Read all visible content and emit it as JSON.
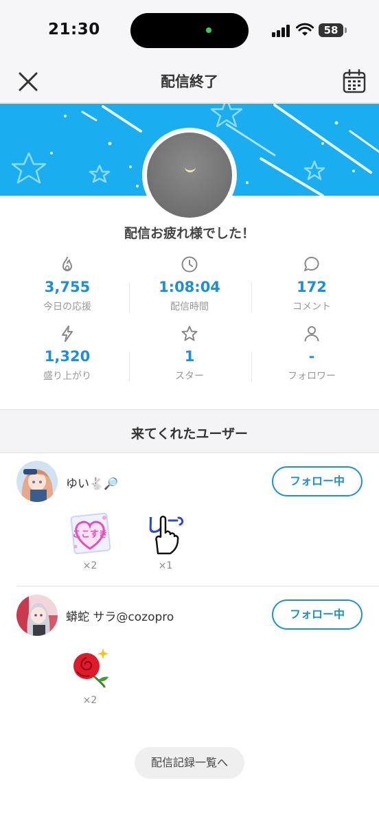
{
  "status_bar": {
    "time": "21:30",
    "battery": "58"
  },
  "nav": {
    "title": "配信終了",
    "close_icon": "close-icon",
    "calendar_icon": "calendar-icon"
  },
  "summary": {
    "message": "配信お疲れ様でした！"
  },
  "stats": [
    {
      "icon": "flame-icon",
      "value": "3,755",
      "label": "今日の応援"
    },
    {
      "icon": "clock-icon",
      "value": "1:08:04",
      "label": "配信時間"
    },
    {
      "icon": "comment-icon",
      "value": "172",
      "label": "コメント"
    },
    {
      "icon": "bolt-icon",
      "value": "1,320",
      "label": "盛り上がり"
    },
    {
      "icon": "star-icon",
      "value": "1",
      "label": "スター"
    },
    {
      "icon": "person-icon",
      "value": "-",
      "label": "フォロワー"
    }
  ],
  "visitors": {
    "title": "来てくれたユーザー",
    "users": [
      {
        "name": "ゆい🐇🔎",
        "follow_label": "フォロー中",
        "gifts": [
          {
            "name": "ここすき",
            "count": "×2"
          },
          {
            "name": "しーっ",
            "count": "×1"
          }
        ]
      },
      {
        "name": "蟒蛇 サラ@cozopro",
        "follow_label": "フォロー中",
        "gifts": [
          {
            "name": "rose",
            "count": "×2"
          }
        ]
      }
    ]
  },
  "footer": {
    "history_label": "配信記録一覧へ"
  },
  "colors": {
    "accent": "#1c8fd8",
    "banner": "#1aaef0"
  }
}
